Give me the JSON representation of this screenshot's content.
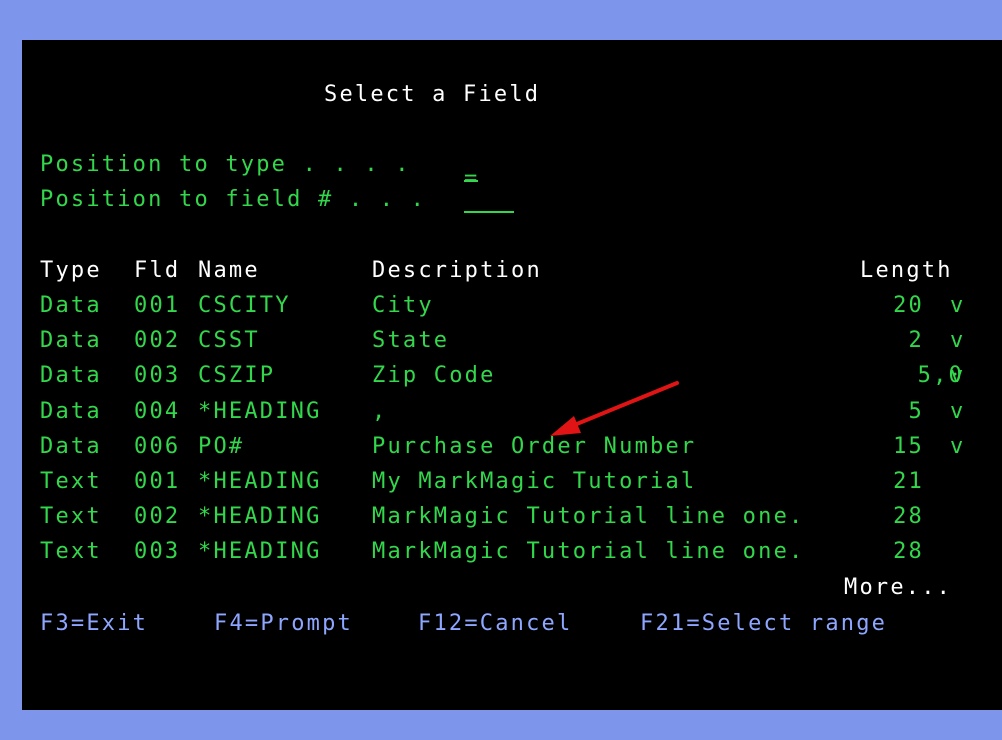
{
  "title": "Select a Field",
  "position": {
    "type_label": "Position to type . . . .",
    "type_value": "=",
    "field_label": "Position to field # . . .",
    "field_value": ""
  },
  "columns": {
    "type": "Type",
    "fld": "Fld",
    "name": "Name",
    "description": "Description",
    "length": "Length"
  },
  "rows": [
    {
      "type": "Data",
      "fld": "001",
      "name": "CSCITY",
      "description": "City",
      "length": "20",
      "flag": "v"
    },
    {
      "type": "Data",
      "fld": "002",
      "name": "CSST",
      "description": "State",
      "length": "2",
      "flag": "v"
    },
    {
      "type": "Data",
      "fld": "003",
      "name": "CSZIP",
      "description": "Zip Code",
      "length": "5,0",
      "flag": "v"
    },
    {
      "type": "Data",
      "fld": "004",
      "name": "*HEADING",
      "description": ",",
      "length": "5",
      "flag": "v"
    },
    {
      "type": "Data",
      "fld": "006",
      "name": "PO#",
      "description": "Purchase Order Number",
      "length": "15",
      "flag": "v"
    },
    {
      "type": "Text",
      "fld": "001",
      "name": "*HEADING",
      "description": "My MarkMagic Tutorial",
      "length": "21",
      "flag": ""
    },
    {
      "type": "Text",
      "fld": "002",
      "name": "*HEADING",
      "description": "MarkMagic Tutorial line one.",
      "length": "28",
      "flag": ""
    },
    {
      "type": "Text",
      "fld": "003",
      "name": "*HEADING",
      "description": "MarkMagic Tutorial line one.",
      "length": "28",
      "flag": ""
    }
  ],
  "more": "More...",
  "fkeys": {
    "f3": "F3=Exit",
    "f4": "F4=Prompt",
    "f12": "F12=Cancel",
    "f21": "F21=Select range"
  },
  "colors": {
    "background_outer": "#7e95ec",
    "screen": "#000000",
    "green": "#33d74c",
    "white": "#ffffff",
    "blue": "#8ea6ff",
    "arrow": "#e01414"
  }
}
